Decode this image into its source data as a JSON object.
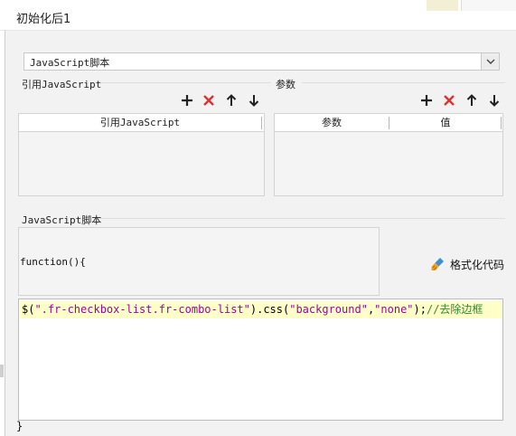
{
  "window": {
    "title": "初始化后1"
  },
  "script_type_select": {
    "value": "JavaScript脚本"
  },
  "ref_js_section": {
    "label": "引用JavaScript",
    "column_header": "引用JavaScript",
    "rows": []
  },
  "params_section": {
    "label": "参数",
    "columns": [
      "参数",
      "值"
    ],
    "rows": []
  },
  "toolbar_icons": [
    "plus-icon",
    "delete-x-icon",
    "arrow-up-icon",
    "arrow-down-icon"
  ],
  "js_section": {
    "label": "JavaScript脚本",
    "function_header": "function(){",
    "format_button_label": "格式化代码",
    "code": {
      "selector_open": "$(",
      "selector": "\".fr-checkbox-list.fr-combo-list\"",
      "method_open": ").css(",
      "arg1": "\"background\"",
      "comma": ",",
      "arg2": "\"none\"",
      "close": ");",
      "comment": "//去除边框"
    },
    "closing_brace": "}"
  },
  "colors": {
    "delete_red": "#e03131",
    "string_purple": "#a4009e",
    "comment_green": "#2d8c2d",
    "highlight_line": "#ffffc8"
  }
}
